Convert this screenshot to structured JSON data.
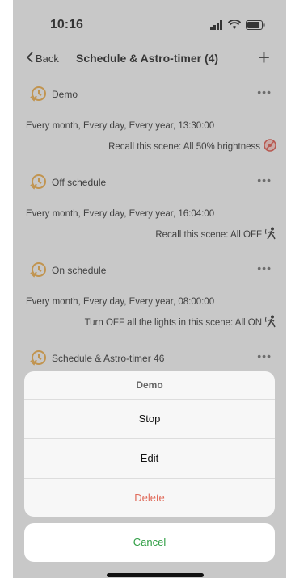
{
  "status_bar": {
    "time": "10:16"
  },
  "nav": {
    "back_label": "Back",
    "title": "Schedule & Astro-timer (4)"
  },
  "items": [
    {
      "name": "Demo",
      "schedule": "Every month, Every day, Every year, 13:30:00",
      "action": "Recall this scene: All 50% brightness"
    },
    {
      "name": "Off schedule",
      "schedule": "Every month, Every day, Every year, 16:04:00",
      "action": "Recall this scene: All OFF"
    },
    {
      "name": "On schedule",
      "schedule": "Every month, Every day, Every year, 08:00:00",
      "action": "Turn OFF all the lights in this scene: All ON"
    },
    {
      "name": "Schedule & Astro-timer 46"
    }
  ],
  "sheet": {
    "title": "Demo",
    "options": [
      "Stop",
      "Edit",
      "Delete"
    ],
    "cancel_label": "Cancel"
  },
  "colors": {
    "accent_green": "#2f9e44",
    "danger": "#e06b5b",
    "icon_orange": "#e8a33a"
  }
}
